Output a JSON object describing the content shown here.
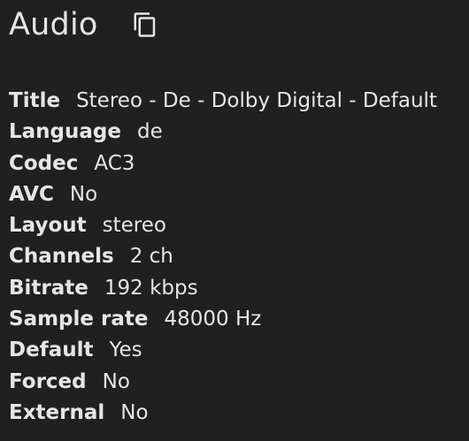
{
  "header": {
    "title": "Audio",
    "copy_icon": "copy-icon"
  },
  "details": [
    {
      "label": "Title",
      "value": "Stereo - De - Dolby Digital - Default"
    },
    {
      "label": "Language",
      "value": "de"
    },
    {
      "label": "Codec",
      "value": "AC3"
    },
    {
      "label": "AVC",
      "value": "No"
    },
    {
      "label": "Layout",
      "value": "stereo"
    },
    {
      "label": "Channels",
      "value": "2 ch"
    },
    {
      "label": "Bitrate",
      "value": "192 kbps"
    },
    {
      "label": "Sample rate",
      "value": "48000 Hz"
    },
    {
      "label": "Default",
      "value": "Yes"
    },
    {
      "label": "Forced",
      "value": "No"
    },
    {
      "label": "External",
      "value": "No"
    }
  ],
  "colors": {
    "background": "#202020",
    "text": "#e6e6e6"
  }
}
